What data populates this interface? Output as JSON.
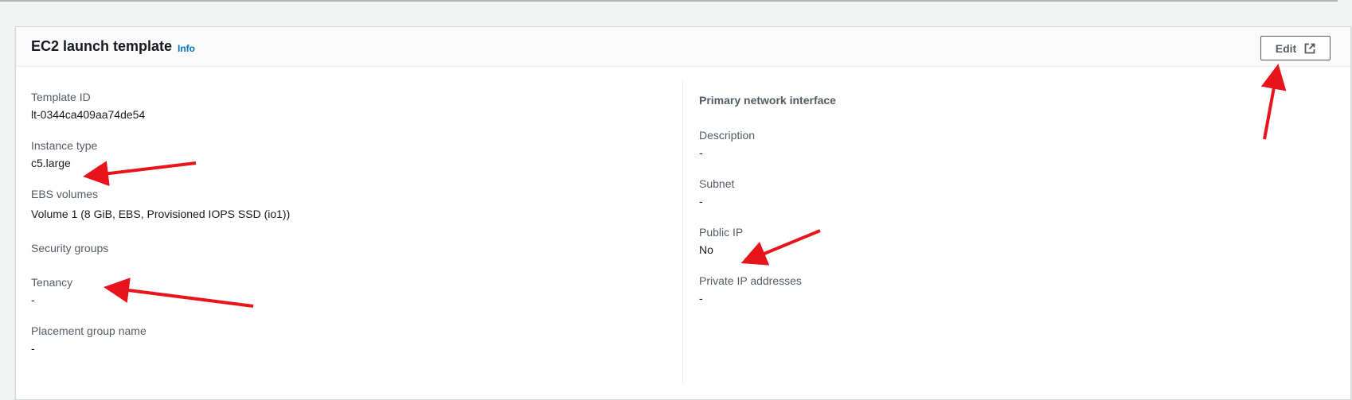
{
  "panel": {
    "title": "EC2 launch template",
    "info_label": "Info",
    "edit_label": "Edit"
  },
  "left_fields": [
    {
      "label": "Template ID",
      "value": "lt-0344ca409aa74de54"
    },
    {
      "label": "Instance type",
      "value": "c5.large"
    },
    {
      "label": "EBS volumes",
      "value": "Volume 1 (8 GiB, EBS, Provisioned IOPS SSD (io1))"
    },
    {
      "label": "Security groups",
      "value": ""
    },
    {
      "label": "Tenancy",
      "value": "-"
    },
    {
      "label": "Placement group name",
      "value": "-"
    }
  ],
  "right_section": {
    "heading": "Primary network interface",
    "fields": [
      {
        "label": "Description",
        "value": "-"
      },
      {
        "label": "Subnet",
        "value": "-"
      },
      {
        "label": "Public IP",
        "value": "No"
      },
      {
        "label": "Private IP addresses",
        "value": "-"
      }
    ]
  },
  "colors": {
    "accent_link": "#0073bb",
    "annotation_arrow": "#e8141b",
    "border": "#d5dbdb"
  },
  "icons": {
    "edit": "external-link-icon"
  }
}
